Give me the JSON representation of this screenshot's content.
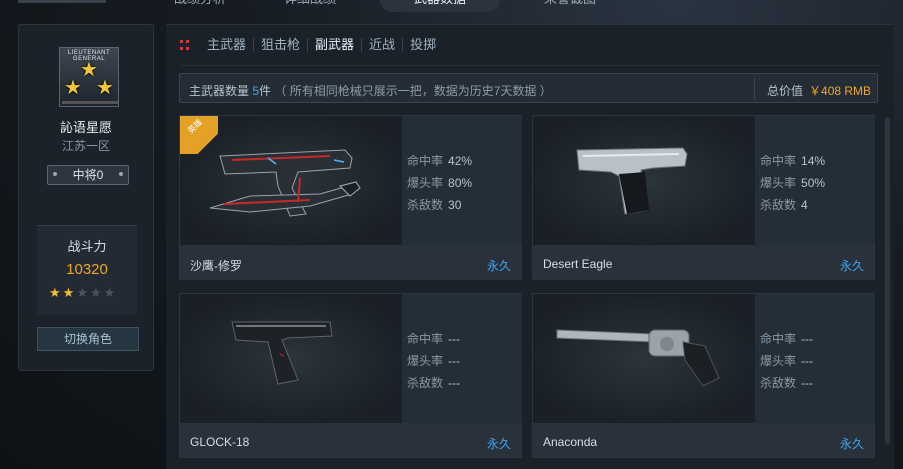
{
  "top_tabs": [
    "战绩分析",
    "详细战绩",
    "武器数据",
    "荣誉截图"
  ],
  "profile": {
    "rank_emblem_text": "LIEUTENANT GENERAL",
    "name": "訫语星愿",
    "server": "江苏一区",
    "rank": "中将0",
    "power_label": "战斗力",
    "power_value": "10320",
    "stars_filled": 2,
    "stars_total": 5,
    "switch_button": "切换角色"
  },
  "weapon_tabs": [
    "主武器",
    "狙击枪",
    "副武器",
    "近战",
    "投掷"
  ],
  "active_weapon_tab": "副武器",
  "summary": {
    "label": "主武器数量",
    "count": "5",
    "unit": "件",
    "note": "（ 所有相同枪械只展示一把，数据为历史7天数据 ）",
    "total_label": "总价值",
    "total_value": "￥408 RMB"
  },
  "weapons": [
    {
      "name": "沙鹰-修罗",
      "badge": "英雄",
      "hit_label": "命中率",
      "hit": "42%",
      "hs_label": "爆头率",
      "hs": "80%",
      "kills_label": "杀敌数",
      "kills": "30",
      "duration": "永久"
    },
    {
      "name": "Desert Eagle",
      "badge": "",
      "hit_label": "命中率",
      "hit": "14%",
      "hs_label": "爆头率",
      "hs": "50%",
      "kills_label": "杀敌数",
      "kills": "4",
      "duration": "永久"
    },
    {
      "name": "GLOCK-18",
      "badge": "",
      "hit_label": "命中率",
      "hit": "---",
      "hs_label": "爆头率",
      "hs": "---",
      "kills_label": "杀敌数",
      "kills": "---",
      "duration": "永久"
    },
    {
      "name": "Anaconda",
      "badge": "",
      "hit_label": "命中率",
      "hit": "---",
      "hs_label": "爆头率",
      "hs": "---",
      "kills_label": "杀敌数",
      "kills": "---",
      "duration": "永久"
    }
  ],
  "colors": {
    "accent_blue": "#3fa5f0",
    "accent_orange": "#f0a623",
    "hero_badge": "#e3a225"
  }
}
